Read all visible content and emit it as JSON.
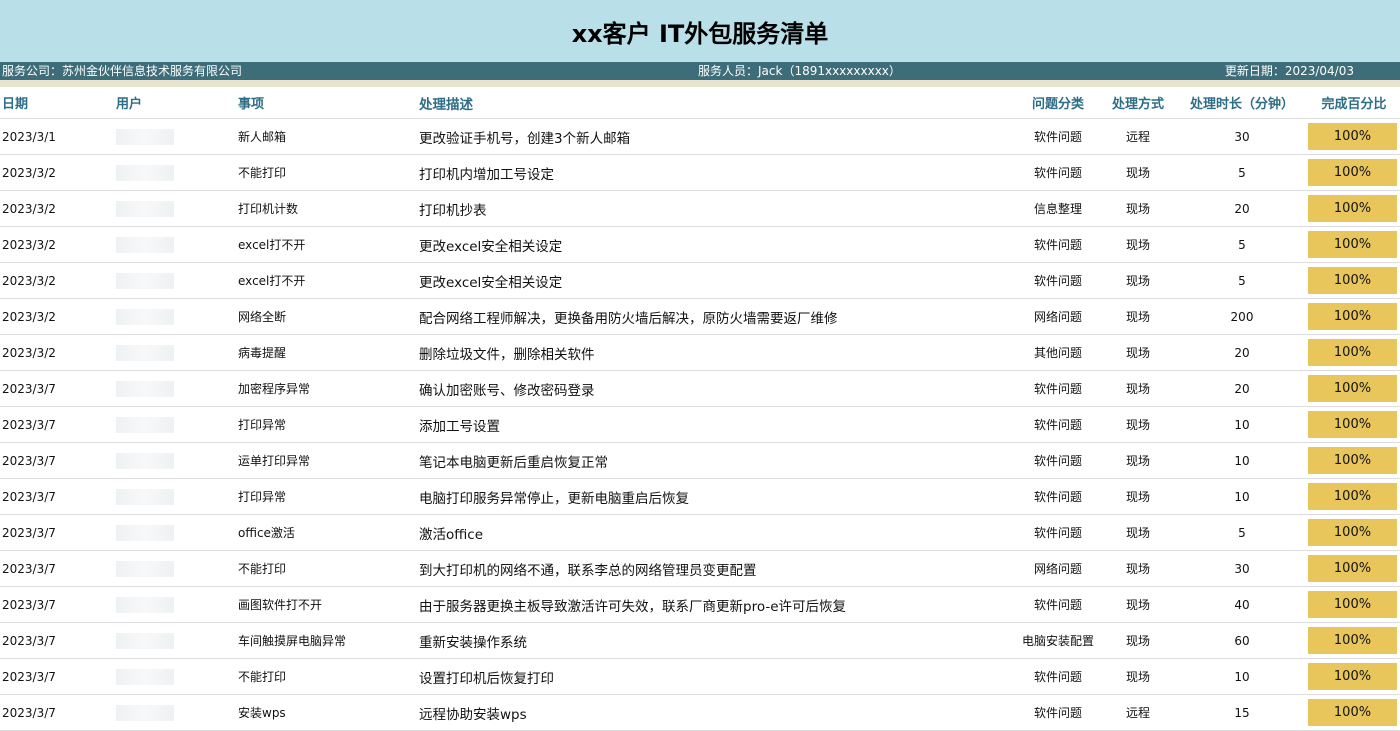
{
  "title": "xx客户 IT外包服务清单",
  "info": {
    "company": "服务公司：苏州金伙伴信息技术服务有限公司",
    "staff": "服务人员：Jack（1891xxxxxxxxx）",
    "update": "更新日期：2023/04/03"
  },
  "columns": [
    "日期",
    "用户",
    "事项",
    "处理描述",
    "问题分类",
    "处理方式",
    "处理时长（分钟）",
    "完成百分比"
  ],
  "rows": [
    {
      "date": "2023/3/1",
      "user": "",
      "item": "新人邮箱",
      "desc": "更改验证手机号，创建3个新人邮箱",
      "cat": "软件问题",
      "method": "远程",
      "dur": "30",
      "pct": "100%"
    },
    {
      "date": "2023/3/2",
      "user": "",
      "item": "不能打印",
      "desc": "打印机内增加工号设定",
      "cat": "软件问题",
      "method": "现场",
      "dur": "5",
      "pct": "100%"
    },
    {
      "date": "2023/3/2",
      "user": "",
      "item": "打印机计数",
      "desc": "打印机抄表",
      "cat": "信息整理",
      "method": "现场",
      "dur": "20",
      "pct": "100%"
    },
    {
      "date": "2023/3/2",
      "user": "",
      "item": "excel打不开",
      "desc": "更改excel安全相关设定",
      "cat": "软件问题",
      "method": "现场",
      "dur": "5",
      "pct": "100%"
    },
    {
      "date": "2023/3/2",
      "user": "",
      "item": "excel打不开",
      "desc": "更改excel安全相关设定",
      "cat": "软件问题",
      "method": "现场",
      "dur": "5",
      "pct": "100%"
    },
    {
      "date": "2023/3/2",
      "user": "",
      "item": "网络全断",
      "desc": "配合网络工程师解决，更换备用防火墙后解决，原防火墙需要返厂维修",
      "cat": "网络问题",
      "method": "现场",
      "dur": "200",
      "pct": "100%"
    },
    {
      "date": "2023/3/2",
      "user": "",
      "item": "病毒提醒",
      "desc": "删除垃圾文件，删除相关软件",
      "cat": "其他问题",
      "method": "现场",
      "dur": "20",
      "pct": "100%"
    },
    {
      "date": "2023/3/7",
      "user": "",
      "item": "加密程序异常",
      "desc": "确认加密账号、修改密码登录",
      "cat": "软件问题",
      "method": "现场",
      "dur": "20",
      "pct": "100%"
    },
    {
      "date": "2023/3/7",
      "user": "",
      "item": "打印异常",
      "desc": "添加工号设置",
      "cat": "软件问题",
      "method": "现场",
      "dur": "10",
      "pct": "100%"
    },
    {
      "date": "2023/3/7",
      "user": "",
      "item": "运单打印异常",
      "desc": "笔记本电脑更新后重启恢复正常",
      "cat": "软件问题",
      "method": "现场",
      "dur": "10",
      "pct": "100%"
    },
    {
      "date": "2023/3/7",
      "user": "",
      "item": "打印异常",
      "desc": "电脑打印服务异常停止，更新电脑重启后恢复",
      "cat": "软件问题",
      "method": "现场",
      "dur": "10",
      "pct": "100%"
    },
    {
      "date": "2023/3/7",
      "user": "",
      "item": "office激活",
      "desc": "激活office",
      "cat": "软件问题",
      "method": "现场",
      "dur": "5",
      "pct": "100%"
    },
    {
      "date": "2023/3/7",
      "user": "",
      "item": "不能打印",
      "desc": "到大打印机的网络不通，联系李总的网络管理员变更配置",
      "cat": "网络问题",
      "method": "现场",
      "dur": "30",
      "pct": "100%"
    },
    {
      "date": "2023/3/7",
      "user": "",
      "item": "画图软件打不开",
      "desc": "由于服务器更换主板导致激活许可失效，联系厂商更新pro-e许可后恢复",
      "cat": "软件问题",
      "method": "现场",
      "dur": "40",
      "pct": "100%"
    },
    {
      "date": "2023/3/7",
      "user": "",
      "item": "车间触摸屏电脑异常",
      "desc": "重新安装操作系统",
      "cat": "电脑安装配置",
      "method": "现场",
      "dur": "60",
      "pct": "100%"
    },
    {
      "date": "2023/3/7",
      "user": "",
      "item": "不能打印",
      "desc": "设置打印机后恢复打印",
      "cat": "软件问题",
      "method": "现场",
      "dur": "10",
      "pct": "100%"
    },
    {
      "date": "2023/3/7",
      "user": "",
      "item": "安装wps",
      "desc": "远程协助安装wps",
      "cat": "软件问题",
      "method": "远程",
      "dur": "15",
      "pct": "100%"
    }
  ]
}
